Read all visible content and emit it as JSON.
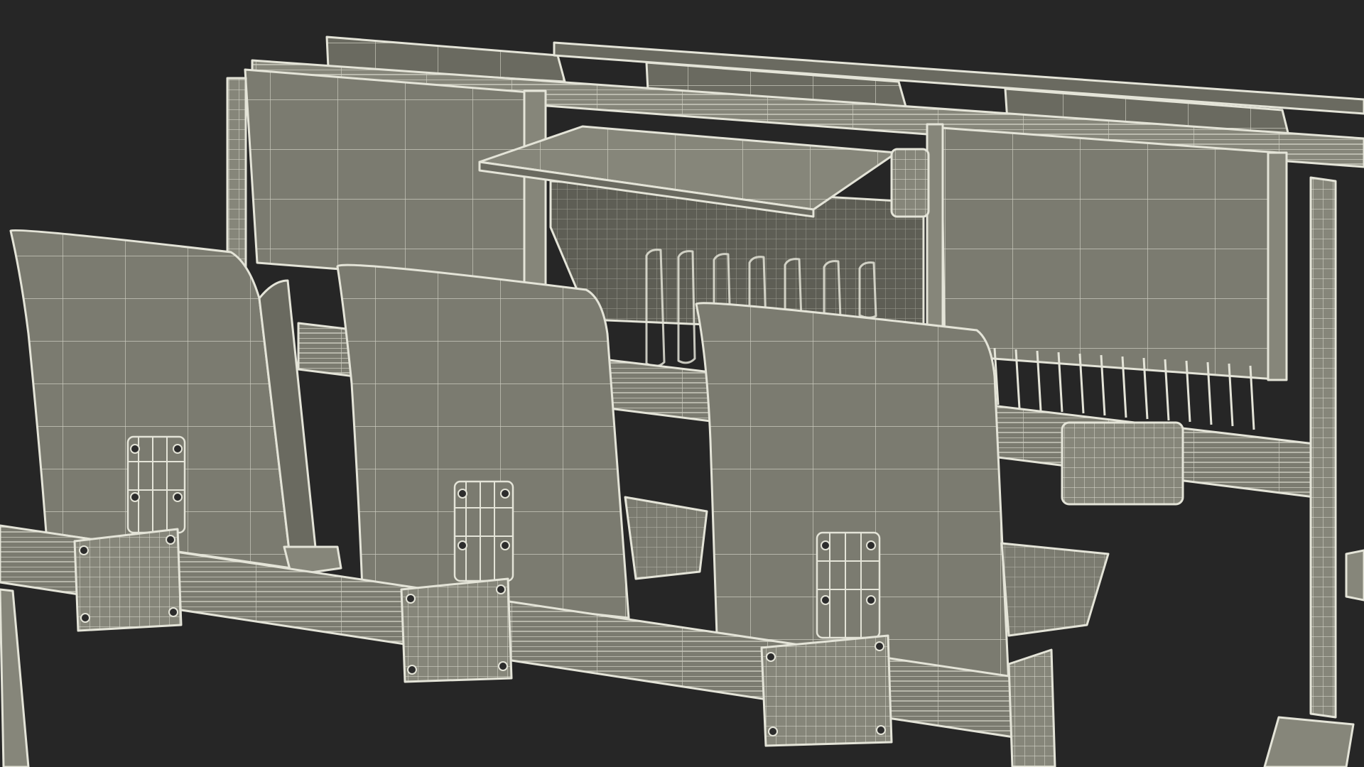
{
  "scene": {
    "background_color": "#262626",
    "material_color": "#7b7b70",
    "wire_color": "#e4e4d8"
  },
  "objects": {
    "front_rear_seat_backs": 3,
    "back_row_writing_panels": 2,
    "fold_out_tablet": 1,
    "mounting_brackets": 3
  }
}
